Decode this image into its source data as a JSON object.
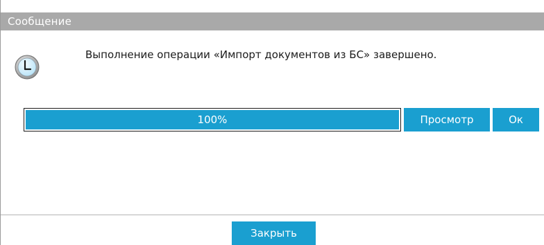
{
  "dialog": {
    "title": "Сообщение",
    "icon": "clock-icon",
    "message": "Выполнение операции «Импорт документов из БС» завершено.",
    "progress": {
      "value_percent": 100,
      "label": "100%"
    },
    "buttons": {
      "view_label": "Просмотр",
      "ok_label": "Ок",
      "close_label": "Закрыть"
    }
  },
  "colors": {
    "accent": "#1a9fd0",
    "titlebar": "#a9a9a9"
  }
}
